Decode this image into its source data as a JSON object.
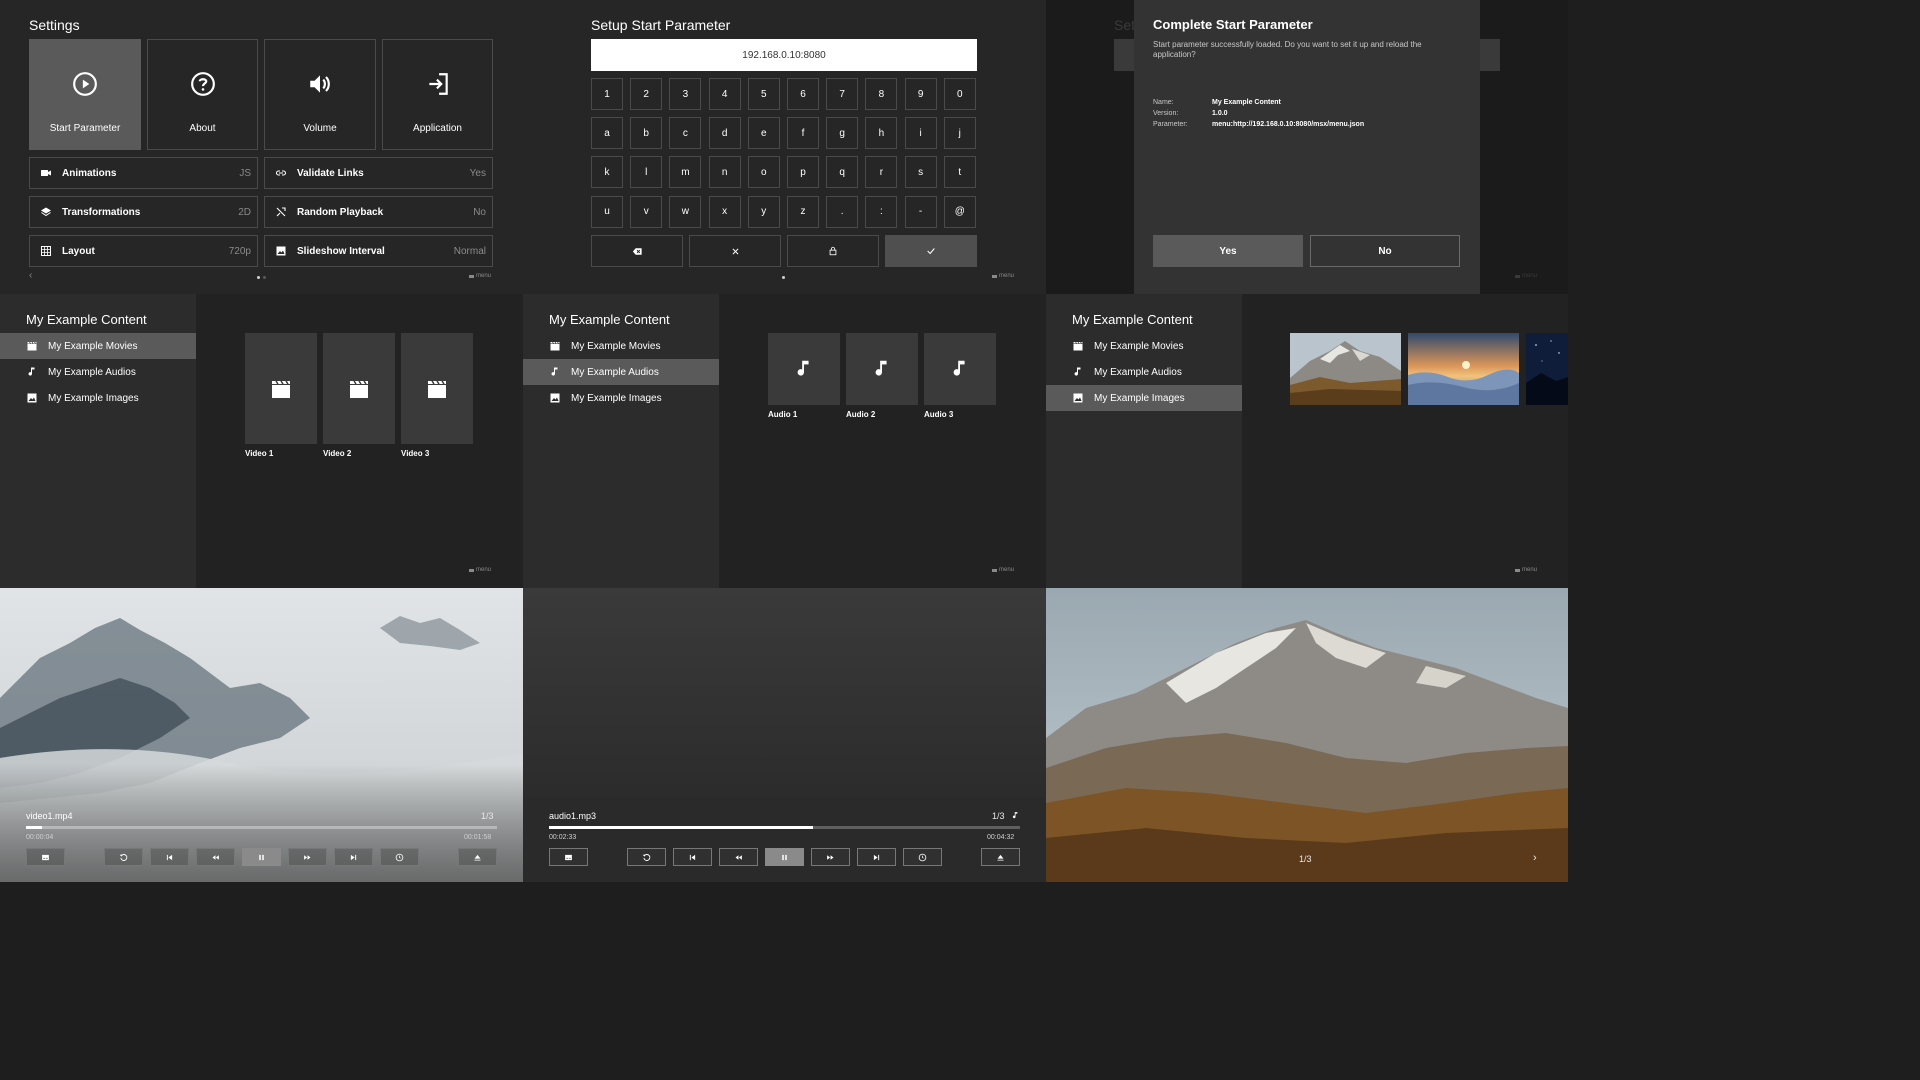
{
  "colors": {
    "panel": "#262626",
    "selected": "#5a5a5a",
    "border": "#4a4a4a",
    "muted": "#8a8a8a",
    "input_bg": "#ffffff",
    "progress": "#ffffff"
  },
  "settings": {
    "title": "Settings",
    "tiles": [
      {
        "label": "Start Parameter",
        "icon": "play-circle-icon",
        "selected": true
      },
      {
        "label": "About",
        "icon": "help-icon",
        "selected": false
      },
      {
        "label": "Volume",
        "icon": "volume-icon",
        "selected": false
      },
      {
        "label": "Application",
        "icon": "exit-icon",
        "selected": false
      }
    ],
    "rows": [
      {
        "label": "Animations",
        "value": "JS",
        "icon": "camera-icon"
      },
      {
        "label": "Validate Links",
        "value": "Yes",
        "icon": "link-icon"
      },
      {
        "label": "Transformations",
        "value": "2D",
        "icon": "layers-icon"
      },
      {
        "label": "Random Playback",
        "value": "No",
        "icon": "shuffle-icon"
      },
      {
        "label": "Layout",
        "value": "720p",
        "icon": "grid-icon"
      },
      {
        "label": "Slideshow Interval",
        "value": "Normal",
        "icon": "image-icon"
      }
    ],
    "footer": "menu",
    "nav_left": "‹"
  },
  "setup": {
    "title": "Setup Start Parameter",
    "input_value": "192.168.0.10:8080",
    "keys": [
      [
        "1",
        "2",
        "3",
        "4",
        "5",
        "6",
        "7",
        "8",
        "9",
        "0"
      ],
      [
        "a",
        "b",
        "c",
        "d",
        "e",
        "f",
        "g",
        "h",
        "i",
        "j"
      ],
      [
        "k",
        "l",
        "m",
        "n",
        "o",
        "p",
        "q",
        "r",
        "s",
        "t"
      ],
      [
        "u",
        "v",
        "w",
        "x",
        "y",
        "z",
        ".",
        ":",
        "-",
        "@"
      ]
    ],
    "actions": [
      {
        "icon": "backspace-icon",
        "selected": false
      },
      {
        "icon": "clear-icon",
        "selected": false
      },
      {
        "icon": "lock-icon",
        "selected": false
      },
      {
        "icon": "check-icon",
        "selected": true
      }
    ],
    "footer": "menu"
  },
  "dialog": {
    "title": "Complete Start Parameter",
    "message": "Start parameter successfully loaded. Do you want to set it up and reload the application?",
    "info": [
      {
        "key": "Name:",
        "value": "My Example Content"
      },
      {
        "key": "Version:",
        "value": "1.0.0"
      },
      {
        "key": "Parameter:",
        "value": "menu:http://192.168.0.10:8080/msx/menu.json"
      }
    ],
    "yes": "Yes",
    "no": "No",
    "bg_title": "Set",
    "footer": "menu"
  },
  "content": {
    "title": "My Example Content",
    "menu": [
      {
        "label": "My Example Movies",
        "icon": "clapper-icon"
      },
      {
        "label": "My Example Audios",
        "icon": "music-note-icon"
      },
      {
        "label": "My Example Images",
        "icon": "image-icon"
      }
    ],
    "videos": [
      "Video 1",
      "Video 2",
      "Video 3"
    ],
    "audios": [
      "Audio 1",
      "Audio 2",
      "Audio 3"
    ],
    "footer": "menu"
  },
  "video_player": {
    "file": "video1.mp4",
    "counter": "1/3",
    "current": "00:00:04",
    "duration": "00:01:58",
    "progress": 0.035
  },
  "audio_player": {
    "file": "audio1.mp3",
    "counter": "1/3",
    "current": "00:02:33",
    "duration": "00:04:32",
    "progress": 0.56
  },
  "image_viewer": {
    "counter": "1/3",
    "next": "›"
  }
}
